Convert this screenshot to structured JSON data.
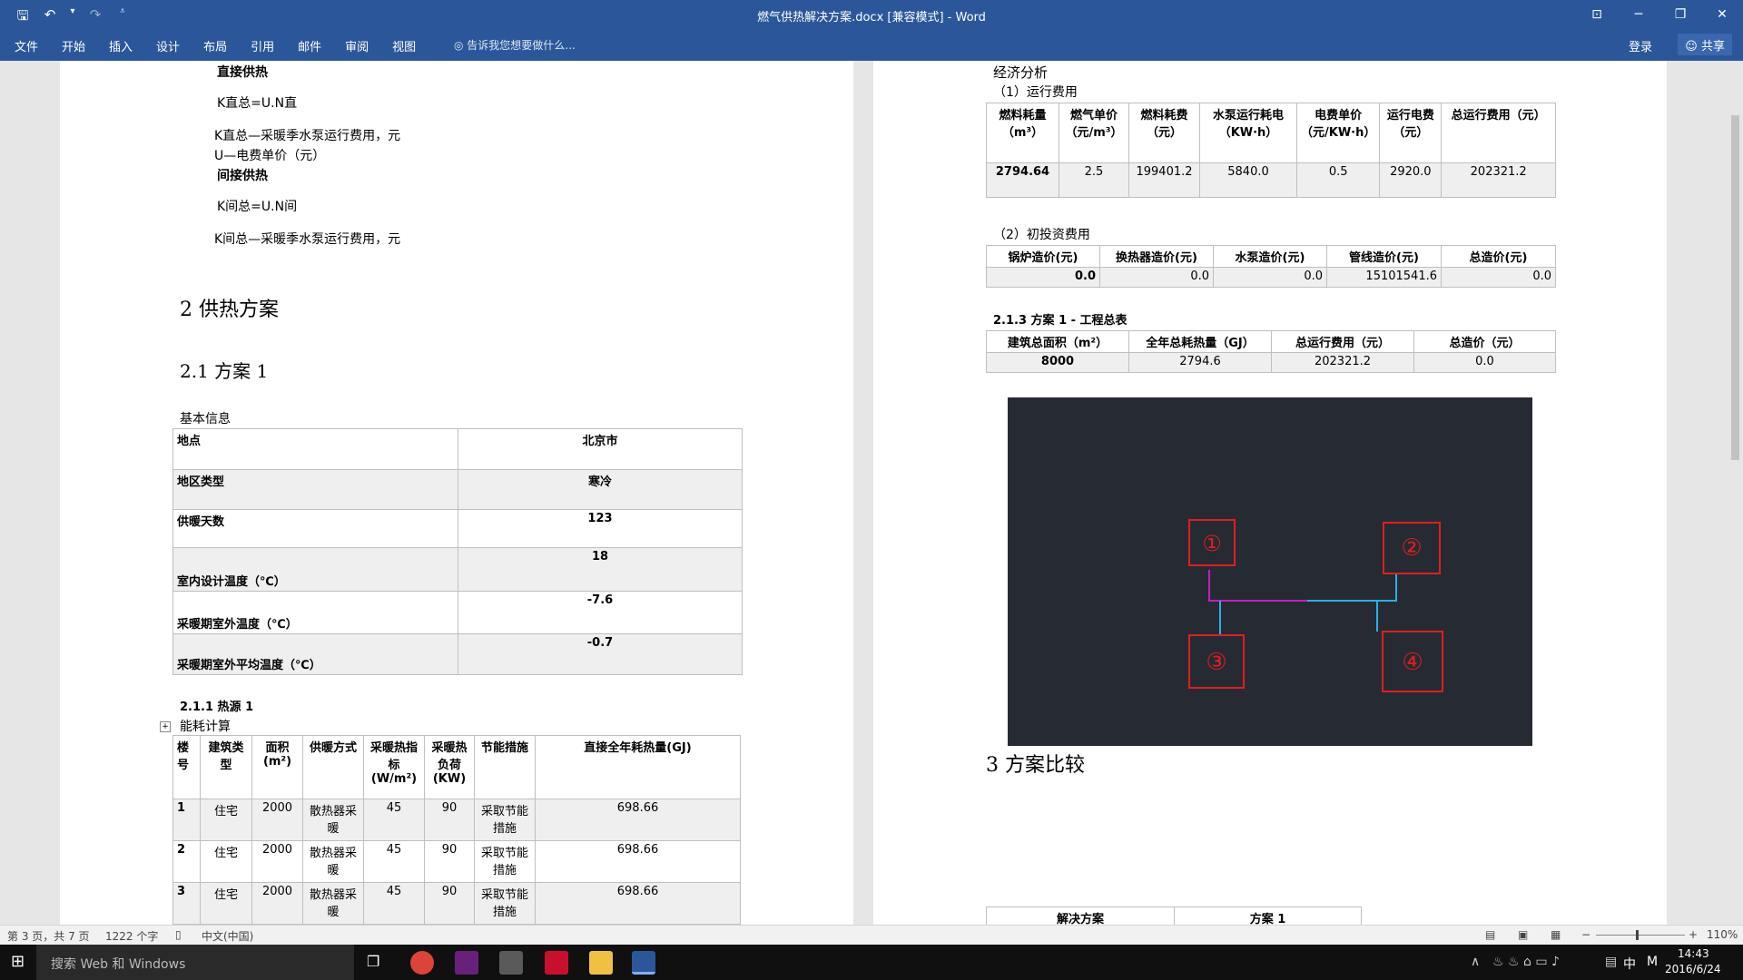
{
  "window": {
    "title": "燃气供热解决方案.docx [兼容模式] - Word",
    "qat": {
      "save": "🖫",
      "undo": "↶",
      "undo_drop": "▾",
      "redo": "↷",
      "customize": "⩡"
    },
    "controls": {
      "ribbon_display": "⊡",
      "minimize": "─",
      "restore": "❐",
      "close": "✕"
    }
  },
  "ribbon": {
    "tabs": [
      "文件",
      "开始",
      "插入",
      "设计",
      "布局",
      "引用",
      "邮件",
      "审阅",
      "视图"
    ],
    "tell_me": "告诉我您想要做什么...",
    "login": "登录",
    "share": "共享"
  },
  "page1": {
    "direct_heading": "直接供热",
    "formula1": "K直总=U.N直",
    "note1": "K直总—采暖季水泵运行费用，元",
    "note2": "U—电费单价（元）",
    "indirect_heading": "间接供热",
    "formula2": "K间总=U.N间",
    "note3": "K间总—采暖季水泵运行费用，元",
    "h2_plan": "2 供热方案",
    "h3_plan1": "2.1 方案 1",
    "basic_info": "基本信息",
    "info_table": [
      [
        "地点",
        "北京市"
      ],
      [
        "地区类型",
        "寒冷"
      ],
      [
        "供暖天数",
        "123"
      ],
      [
        "室内设计温度（℃）",
        "18"
      ],
      [
        "采暖期室外温度（℃）",
        "-7.6"
      ],
      [
        "采暖期室外平均温度（℃）",
        "-0.7"
      ]
    ],
    "h4_source": "2.1.1 热源 1",
    "energy_calc": "能耗计算",
    "energy_headers": [
      "楼号",
      "建筑类型",
      "面积(m²)",
      "供暖方式",
      "采暖热指标(W/m²)",
      "采暖热负荷(KW)",
      "节能措施",
      "直接全年耗热量(GJ)"
    ],
    "energy_rows": [
      [
        "1",
        "住宅",
        "2000",
        "散热器采暖",
        "45",
        "90",
        "采取节能措施",
        "698.66"
      ],
      [
        "2",
        "住宅",
        "2000",
        "散热器采暖",
        "45",
        "90",
        "采取节能措施",
        "698.66"
      ],
      [
        "3",
        "住宅",
        "2000",
        "散热器采暖",
        "45",
        "90",
        "采取节能措施",
        "698.66"
      ]
    ]
  },
  "page2": {
    "econ": "经济分析",
    "run_cost": "（1）运行费用",
    "run_headers": [
      "燃料耗量（m³）",
      "燃气单价（元/m³）",
      "燃料耗费（元）",
      "水泵运行耗电（KW·h）",
      "电费单价（元/KW·h）",
      "运行电费（元）",
      "总运行费用（元）"
    ],
    "run_row": [
      "2794.64",
      "2.5",
      "199401.2",
      "5840.0",
      "0.5",
      "2920.0",
      "202321.2"
    ],
    "invest": "（2）初投资费用",
    "invest_headers": [
      "锅炉造价(元)",
      "换热器造价(元)",
      "水泵造价(元)",
      "管线造价(元)",
      "总造价(元)"
    ],
    "invest_row": [
      "0.0",
      "0.0",
      "0.0",
      "15101541.6",
      "0.0"
    ],
    "summary_title": "2.1.3 方案 1 - 工程总表",
    "summary_headers": [
      "建筑总面积（m²）",
      "全年总耗热量（GJ）",
      "总运行费用（元）",
      "总造价（元）"
    ],
    "summary_row": [
      "8000",
      "2794.6",
      "202321.2",
      "0.0"
    ],
    "nodes": [
      "①",
      "②",
      "③",
      "④"
    ],
    "h2_compare": "3 方案比较",
    "compare_headers": [
      "解决方案",
      "方案 1"
    ]
  },
  "status": {
    "page": "第 3 页，共 7 页",
    "words": "1222 个字",
    "lang": "中文(中国)",
    "zoom": "110%"
  },
  "taskbar": {
    "search": "搜索 Web 和 Windows",
    "time": "14:43",
    "date": "2016/6/24",
    "ime": "中",
    "ime_mode": "M"
  },
  "colors": {
    "accent": "#2b579a",
    "diagram_bg": "#262a33",
    "node_red": "#e01e1e",
    "pipe_magenta": "#c020c0",
    "pipe_cyan": "#2ab0e6"
  }
}
